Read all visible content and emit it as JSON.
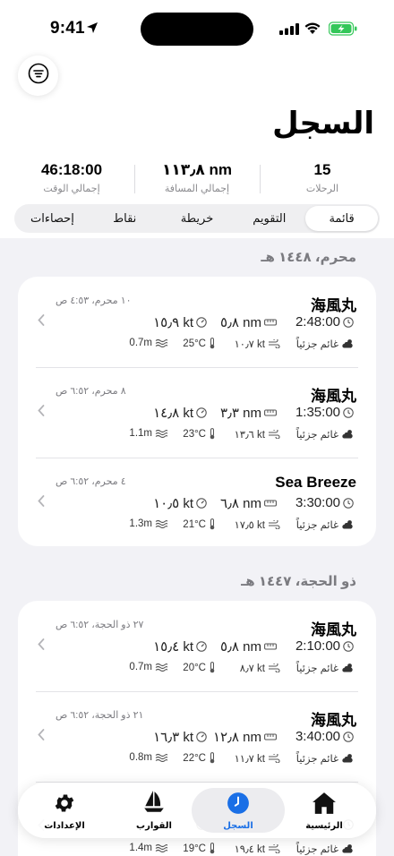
{
  "status_bar": {
    "time": "9:41"
  },
  "page": {
    "title": "السجل"
  },
  "stats": [
    {
      "value": "15",
      "label": "الرحلات"
    },
    {
      "value": "١١٣٫٨ nm",
      "label": "إجمالي المسافة"
    },
    {
      "value": "46:18:00",
      "label": "إجمالي الوقت"
    }
  ],
  "segments": [
    "قائمة",
    "التقويم",
    "خريطة",
    "نقاط",
    "إحصاءات"
  ],
  "sections": [
    {
      "title": "محرم، ١٤٤٨ هـ",
      "entries": [
        {
          "boat": "海風丸",
          "date": "١٠ محرم، ٤:٥٣ ص",
          "duration": "2:48:00",
          "distance": "٥٫٨ nm",
          "speed": "١٥٫٩ kt",
          "weather": "غائم جزئياً",
          "wind": "١٠٫٧ kt",
          "temp": "25°C",
          "wave": "0.7m"
        },
        {
          "boat": "海風丸",
          "date": "٨ محرم، ٦:٥٢ ص",
          "duration": "1:35:00",
          "distance": "٣٫٣ nm",
          "speed": "١٤٫٨ kt",
          "weather": "غائم جزئياً",
          "wind": "١٣٫٦ kt",
          "temp": "23°C",
          "wave": "1.1m"
        },
        {
          "boat": "Sea Breeze",
          "date": "٤ محرم، ٦:٥٢ ص",
          "duration": "3:30:00",
          "distance": "٦٫٨ nm",
          "speed": "١٠٫٥ kt",
          "weather": "غائم جزئياً",
          "wind": "١٧٫٥ kt",
          "temp": "21°C",
          "wave": "1.3m"
        }
      ]
    },
    {
      "title": "ذو الحجة، ١٤٤٧ هـ",
      "entries": [
        {
          "boat": "海風丸",
          "date": "٢٧ ذو الحجة، ٦:٥٢ ص",
          "duration": "2:10:00",
          "distance": "٥٫٨ nm",
          "speed": "١٥٫٤ kt",
          "weather": "غائم جزئياً",
          "wind": "٨٫٧ kt",
          "temp": "20°C",
          "wave": "0.7m"
        },
        {
          "boat": "海風丸",
          "date": "٢١ ذو الحجة، ٦:٥٢ ص",
          "duration": "3:40:00",
          "distance": "١٢٫٨ nm",
          "speed": "١٦٫٣ kt",
          "weather": "غائم جزئياً",
          "wind": "١١٫٧ kt",
          "temp": "22°C",
          "wave": "0.8m"
        },
        {
          "boat": "",
          "date": "",
          "duration": "",
          "distance": "",
          "speed": "",
          "weather": "غائم جزئياً",
          "wind": "١٩٫٤ kt",
          "temp": "19°C",
          "wave": "1.4m"
        }
      ]
    }
  ],
  "tabs": [
    {
      "label": "الرئيسية",
      "icon": "home-icon"
    },
    {
      "label": "السجل",
      "icon": "clock-icon"
    },
    {
      "label": "القوارب",
      "icon": "sailboat-icon"
    },
    {
      "label": "الإعدادات",
      "icon": "gear-icon"
    }
  ],
  "colors": {
    "accent": "#1a6fe6",
    "background": "#f2f2f6",
    "battery": "#34c759"
  }
}
